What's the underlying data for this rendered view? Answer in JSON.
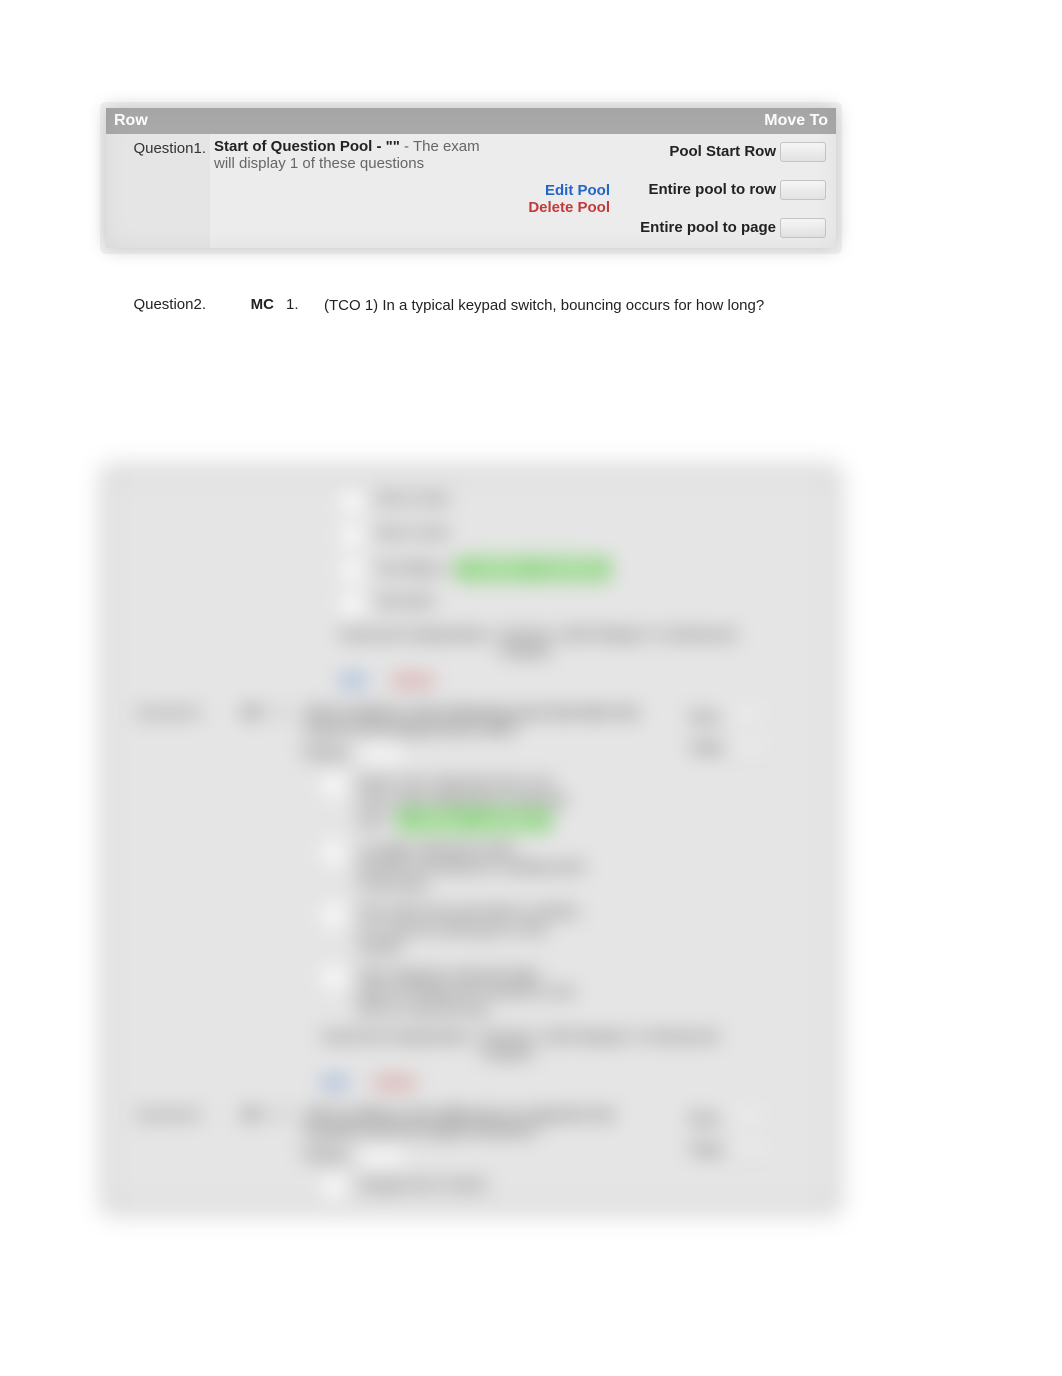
{
  "header": {
    "left": "Row",
    "right": "Move To"
  },
  "row1": {
    "label": "Question1.",
    "pool_title_prefix": "Start of Question Pool - \"\"",
    "pool_title_suffix": " - The exam will display 1 of these questions",
    "actions": {
      "edit": "Edit Pool",
      "delete": "Delete Pool"
    },
    "move": {
      "opt1": "Pool Start Row",
      "opt2": "Entire pool to row",
      "opt3": "Entire pool to page"
    }
  },
  "q2": {
    "label": "Question2.",
    "type": "MC",
    "index": "1.",
    "text": "(TCO 1) In a typical keypad switch, bouncing occurs for how long?"
  },
  "blurred": {
    "correct_pill": "CORRECT ANSWER",
    "meta_left": "Instructor Explanation:",
    "meta_right_line1": "Section \"LED Display\" in Advanced",
    "meta_right_line2": "Keypad",
    "edit": "Edit",
    "delete": "Delete",
    "q3": {
      "label": "Question3.",
      "type": "MC",
      "index": "2.",
      "text_l1": "(TCO 1) Which of the following most describes the",
      "text_l2": "code for the keypad decal read?",
      "points_label": "Points:",
      "opts": {
        "a_l1": "Each case statement has one",
        "a_l2": "more case statement to decode",
        "a_l3": "pins",
        "b_l1": "A single statement with",
        "b_l2": "priority encoding for reading each",
        "b_l3": "of the pins",
        "c_l1": "The entire key pad data is written",
        "c_l2": "in C and all code goes in the",
        "c_l3": "main()",
        "d_l1": "This requires external logic",
        "d_l2": "gates (74138) and hooked to one",
        "d_l3": "port to read the key"
      },
      "side_row": "Row",
      "side_page": "Page"
    },
    "q4": {
      "label": "Question4.",
      "type": "MC",
      "index": "3.",
      "text_l1": "(TCO 1) What is the difference in using the 4x4",
      "text_l2": "standard and the keypad interface?",
      "points_label": "Points:",
      "opt_a": "Keypad  4x4 / Serial",
      "side_row": "Row",
      "side_page": "Page"
    }
  }
}
